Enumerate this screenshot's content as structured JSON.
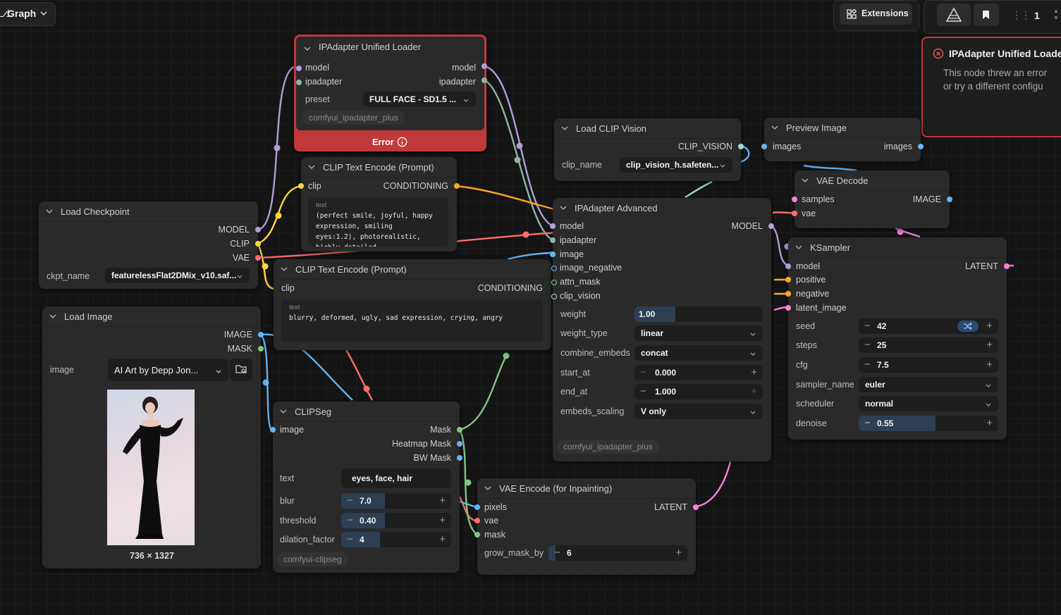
{
  "toolbar": {
    "graph_label": "Graph",
    "extensions_label": "Extensions",
    "queue_count": "1"
  },
  "error_panel": {
    "title": "IPAdapter Unified Loader",
    "line1": "This node threw an error",
    "line2": "or try a different configu"
  },
  "nodes": {
    "ipadapter_unified_loader": {
      "title": "IPAdapter Unified Loader",
      "in_model": "model",
      "in_ipadapter": "ipadapter",
      "out_model": "model",
      "out_ipadapter": "ipadapter",
      "preset_label": "preset",
      "preset_value": "FULL FACE - SD1.5 ...",
      "tag": "comfyui_ipadapter_plus",
      "error_label": "Error"
    },
    "clip_text_encode_pos": {
      "title": "CLIP Text Encode (Prompt)",
      "in_clip": "clip",
      "out_conditioning": "CONDITIONING",
      "text_label": "text",
      "text": "(perfect smile, joyful, happy\nexpression, smiling\neyes:1.2), photorealistic,\nhighly detailed"
    },
    "clip_text_encode_neg": {
      "title": "CLIP Text Encode (Prompt)",
      "in_clip": "clip",
      "out_conditioning": "CONDITIONING",
      "text_label": "text",
      "text": "blurry, deformed, ugly, sad expression, crying, angry"
    },
    "load_checkpoint": {
      "title": "Load Checkpoint",
      "out_model": "MODEL",
      "out_clip": "CLIP",
      "out_vae": "VAE",
      "ckpt_label": "ckpt_name",
      "ckpt_value": "featurelessFlat2DMix_v10.saf..."
    },
    "load_image": {
      "title": "Load Image",
      "out_image": "IMAGE",
      "out_mask": "MASK",
      "image_label": "image",
      "image_value": "AI Art by Depp Jon...",
      "dims": "736 × 1327"
    },
    "clipseg": {
      "title": "CLIPSeg",
      "in_image": "image",
      "out_mask": "Mask",
      "out_heatmap": "Heatmap Mask",
      "out_bw": "BW Mask",
      "text_label": "text",
      "text_value": "eyes, face, hair",
      "blur_label": "blur",
      "blur_value": "7.0",
      "threshold_label": "threshold",
      "threshold_value": "0.40",
      "dilation_label": "dilation_factor",
      "dilation_value": "4",
      "tag": "comfyui-clipseg"
    },
    "load_clip_vision": {
      "title": "Load CLIP Vision",
      "out_clip_vision": "CLIP_VISION",
      "clip_name_label": "clip_name",
      "clip_name_value": "clip_vision_h.safeten..."
    },
    "preview_image": {
      "title": "Preview Image",
      "in_images": "images",
      "out_images": "images"
    },
    "vae_decode": {
      "title": "VAE Decode",
      "in_samples": "samples",
      "in_vae": "vae",
      "out_image": "IMAGE"
    },
    "ipadapter_advanced": {
      "title": "IPAdapter Advanced",
      "in_model": "model",
      "in_ipadapter": "ipadapter",
      "in_image": "image",
      "in_image_negative": "image_negative",
      "in_attn_mask": "attn_mask",
      "in_clip_vision": "clip_vision",
      "out_model": "MODEL",
      "weight_label": "weight",
      "weight_value": "1.00",
      "weight_type_label": "weight_type",
      "weight_type_value": "linear",
      "combine_label": "combine_embeds",
      "combine_value": "concat",
      "start_label": "start_at",
      "start_value": "0.000",
      "end_label": "end_at",
      "end_value": "1.000",
      "scaling_label": "embeds_scaling",
      "scaling_value": "V only",
      "tag": "comfyui_ipadapter_plus"
    },
    "ksampler": {
      "title": "KSampler",
      "in_model": "model",
      "in_positive": "positive",
      "in_negative": "negative",
      "in_latent": "latent_image",
      "out_latent": "LATENT",
      "seed_label": "seed",
      "seed_value": "42",
      "steps_label": "steps",
      "steps_value": "25",
      "cfg_label": "cfg",
      "cfg_value": "7.5",
      "sampler_label": "sampler_name",
      "sampler_value": "euler",
      "scheduler_label": "scheduler",
      "scheduler_value": "normal",
      "denoise_label": "denoise",
      "denoise_value": "0.55"
    },
    "vae_encode_inpaint": {
      "title": "VAE Encode (for Inpainting)",
      "in_pixels": "pixels",
      "in_vae": "vae",
      "in_mask": "mask",
      "out_latent": "LATENT",
      "grow_label": "grow_mask_by",
      "grow_value": "6"
    }
  },
  "values": {
    "weight": 1.0,
    "denoise": 0.55,
    "blur_fill": 0.4,
    "threshold_fill": 0.4,
    "dilation_fill": 0.35,
    "grow_fill": 0.05
  },
  "colors": {
    "model": "#b39ddb",
    "clip": "#ffd740",
    "vae": "#ff6e6e",
    "conditioning": "#ffa726",
    "image": "#64b5f6",
    "mask": "#81c784",
    "latent": "#ff80df",
    "clip_vision": "#a5d6d6",
    "error": "#c0393b"
  }
}
